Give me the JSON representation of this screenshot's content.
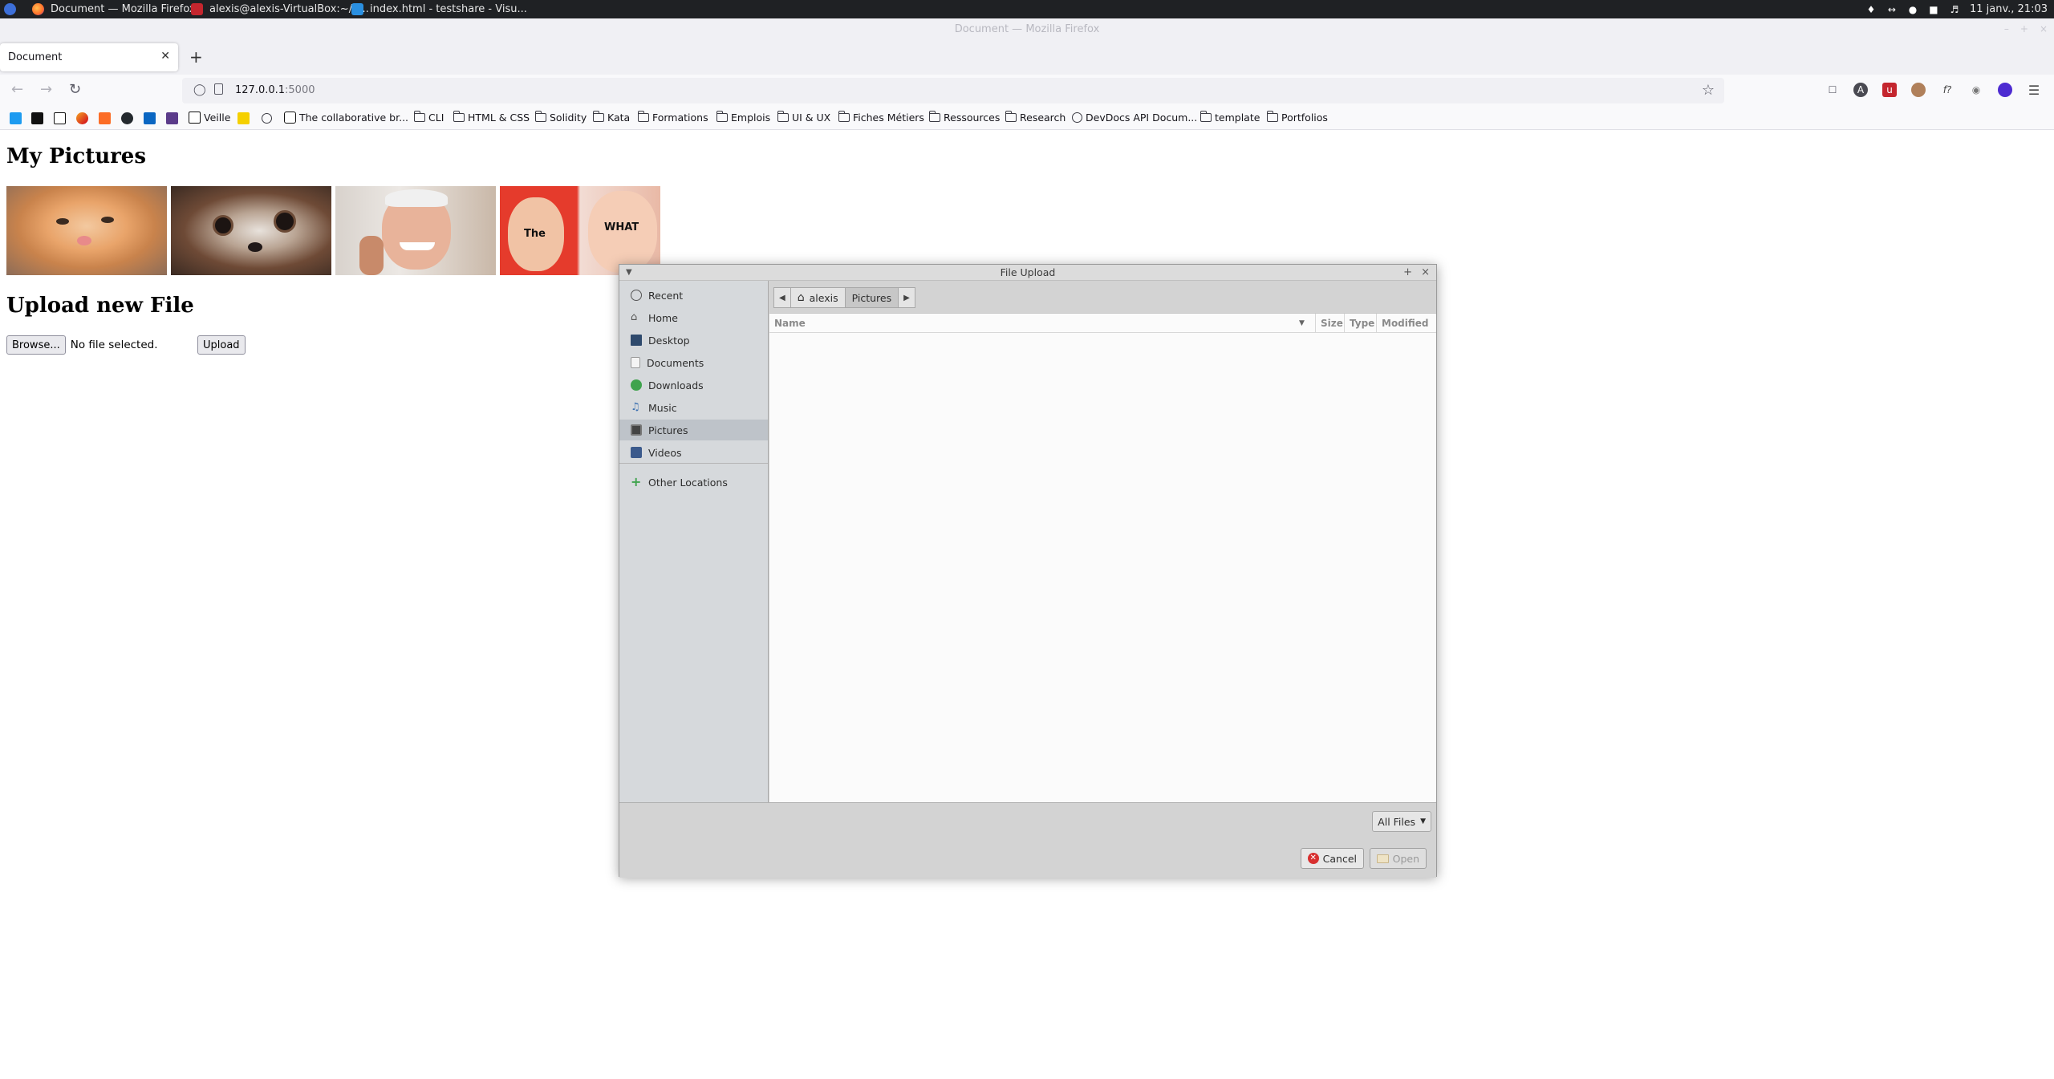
{
  "taskbar": {
    "tasks": [
      {
        "label": "Document — Mozilla Firefox",
        "icon": "firefox-icon"
      },
      {
        "label": "alexis@alexis-VirtualBox:~/d...",
        "icon": "terminal-icon"
      },
      {
        "label": "index.html - testshare - Visu...",
        "icon": "vscode-icon"
      }
    ],
    "clock": "11 janv., 21:03"
  },
  "window": {
    "title": "Document — Mozilla Firefox"
  },
  "browser": {
    "tab_title": "Document",
    "url_host": "127.0.0.1",
    "url_port": ":5000"
  },
  "bookmarks": {
    "veille": "Veille",
    "collab": "The collaborative br...",
    "folders": [
      "CLI",
      "HTML & CSS",
      "Solidity",
      "Kata",
      "Formations",
      "Emplois",
      "UI & UX",
      "Fiches Métiers",
      "Ressources",
      "Research"
    ],
    "devdocs": "DevDocs API Docum...",
    "template": "template",
    "portfolios": "Portfolios"
  },
  "page": {
    "heading": "My Pictures",
    "meme_text_1": "The",
    "meme_text_2": "WHAT",
    "upload_heading": "Upload new File",
    "browse_label": "Browse...",
    "no_file_label": "No file selected.",
    "upload_label": "Upload"
  },
  "dialog": {
    "title": "File Upload",
    "places": [
      {
        "label": "Recent",
        "icon": "clock-icon"
      },
      {
        "label": "Home",
        "icon": "home-icon"
      },
      {
        "label": "Desktop",
        "icon": "desktop-icon"
      },
      {
        "label": "Documents",
        "icon": "document-icon"
      },
      {
        "label": "Downloads",
        "icon": "download-icon"
      },
      {
        "label": "Music",
        "icon": "music-icon"
      },
      {
        "label": "Pictures",
        "icon": "pictures-icon"
      },
      {
        "label": "Videos",
        "icon": "video-icon"
      }
    ],
    "other_locations": "Other Locations",
    "path": [
      "alexis",
      "Pictures"
    ],
    "columns": [
      "Name",
      "Size",
      "Type",
      "Modified"
    ],
    "filter": "All Files",
    "cancel_label": "Cancel",
    "open_label": "Open"
  },
  "colors": {
    "taskbar": "#1f2124",
    "dialog_bg": "#d3d3d3",
    "sidebar_bg": "#d6d9dc",
    "cancel_red": "#d83030"
  }
}
